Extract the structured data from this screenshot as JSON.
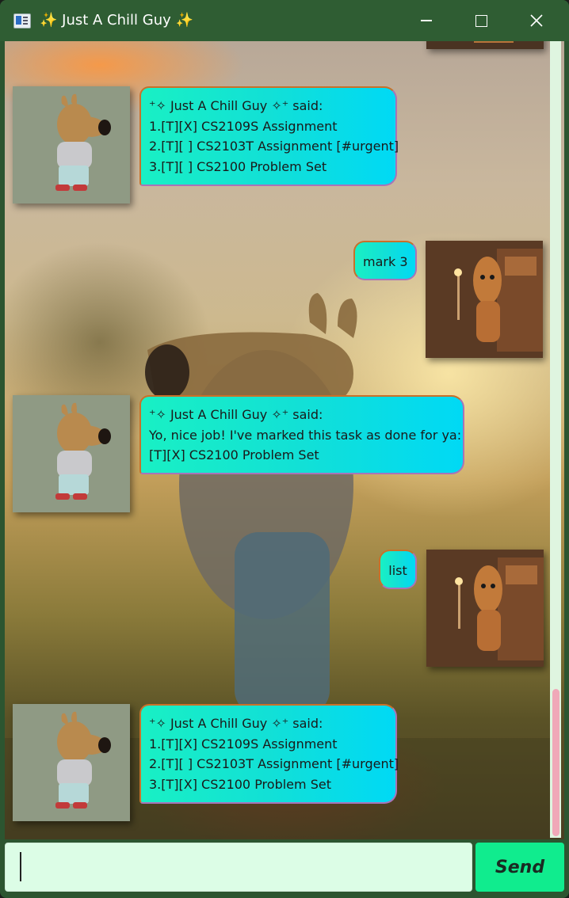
{
  "window": {
    "title": "✨ Just A Chill Guy ✨",
    "minimize_icon": "minimize-icon",
    "maximize_icon": "maximize-icon",
    "close_icon": "close-icon"
  },
  "messages": [
    {
      "sender": "bot",
      "text": "⁺✧ Just A Chill Guy ✧⁺ said:\n1.[T][X] CS2109S Assignment\n2.[T][ ] CS2103T Assignment [#urgent]\n3.[T][ ] CS2100 Problem Set"
    },
    {
      "sender": "user",
      "text": "mark 3"
    },
    {
      "sender": "bot",
      "text": "⁺✧ Just A Chill Guy ✧⁺ said:\nYo, nice job! I've marked this task as done for ya:\n[T][X] CS2100 Problem Set"
    },
    {
      "sender": "user",
      "text": "list"
    },
    {
      "sender": "bot",
      "text": "⁺✧ Just A Chill Guy ✧⁺ said:\n1.[T][X] CS2109S Assignment\n2.[T][ ] CS2103T Assignment [#urgent]\n3.[T][X] CS2100 Problem Set"
    }
  ],
  "input": {
    "value": "",
    "placeholder": ""
  },
  "send_button": {
    "label": "Send"
  },
  "colors": {
    "titlebar": "#2f5d33",
    "bubble_start": "#19f0c4",
    "bubble_end": "#00d9f5",
    "bubble_border": "#c8702a",
    "input_bg": "#dcfde6",
    "send_bg": "#10ec8e",
    "scroll_thumb": "#f0a8b8"
  }
}
